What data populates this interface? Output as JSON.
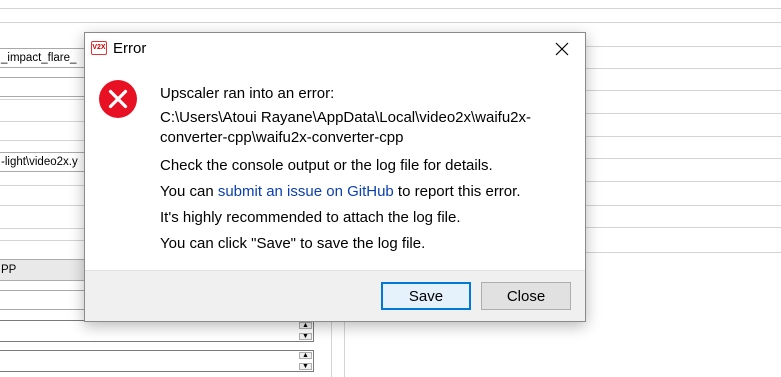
{
  "background": {
    "field_impact": "_impact_flare_",
    "field_video2x": "-light\\video2x.y",
    "combo_value": "PP"
  },
  "dialog": {
    "app_icon_text": "V2X",
    "title": "Error",
    "icon": "error-icon",
    "heading": "Upscaler ran into an error:",
    "path": "C:\\Users\\Atoui Rayane\\AppData\\Local\\video2x\\waifu2x-converter-cpp\\waifu2x-converter-cpp",
    "check_console": "Check the console output or the log file for details.",
    "you_can": "You can ",
    "link_text": "submit an issue on GitHub",
    "report_suffix": " to report this error.",
    "recommend": "It's highly recommended to attach the log file.",
    "save_hint": "You can click \"Save\" to save the log file.",
    "save_button": "Save",
    "close_button": "Close",
    "colors": {
      "link": "#0b3eb2",
      "error_red": "#e81123",
      "default_button_border": "#0078d7"
    }
  }
}
